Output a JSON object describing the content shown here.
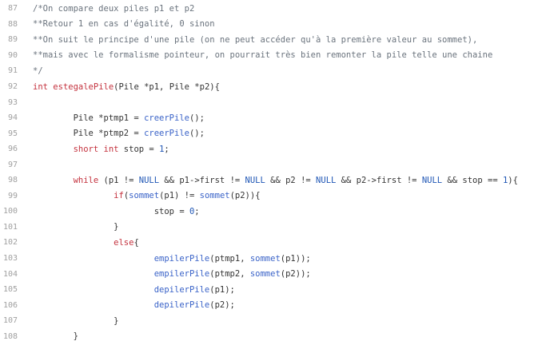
{
  "colors": {
    "line_number": "#a0a0a0",
    "comment": "#6a737d",
    "keyword": "#c4323e",
    "function": "#3a63c8",
    "constant": "#1f56b5",
    "text": "#333333",
    "background": "#ffffff"
  },
  "lines": [
    {
      "num": "87",
      "tokens": [
        {
          "t": "c",
          "v": "/*On compare deux piles p1 et p2"
        }
      ]
    },
    {
      "num": "88",
      "tokens": [
        {
          "t": "c",
          "v": "**Retour 1 en cas d'égalité, 0 sinon"
        }
      ]
    },
    {
      "num": "89",
      "tokens": [
        {
          "t": "c",
          "v": "**On suit le principe d'une pile (on ne peut accéder qu'à la première valeur au sommet),"
        }
      ]
    },
    {
      "num": "90",
      "tokens": [
        {
          "t": "c",
          "v": "**mais avec le formalisme pointeur, on pourrait très bien remonter la pile telle une chaine"
        }
      ]
    },
    {
      "num": "91",
      "tokens": [
        {
          "t": "c",
          "v": "*/"
        }
      ]
    },
    {
      "num": "92",
      "tokens": [
        {
          "t": "k",
          "v": "int"
        },
        {
          "t": "p",
          "v": " "
        },
        {
          "t": "k",
          "v": "estegalePile"
        },
        {
          "t": "p",
          "v": "(Pile *p1, Pile *p2){"
        }
      ]
    },
    {
      "num": "93",
      "tokens": []
    },
    {
      "num": "94",
      "tokens": [
        {
          "t": "p",
          "v": "        Pile *ptmp1 = "
        },
        {
          "t": "f",
          "v": "creerPile"
        },
        {
          "t": "p",
          "v": "();"
        }
      ]
    },
    {
      "num": "95",
      "tokens": [
        {
          "t": "p",
          "v": "        Pile *ptmp2 = "
        },
        {
          "t": "f",
          "v": "creerPile"
        },
        {
          "t": "p",
          "v": "();"
        }
      ]
    },
    {
      "num": "96",
      "tokens": [
        {
          "t": "p",
          "v": "        "
        },
        {
          "t": "k",
          "v": "short"
        },
        {
          "t": "p",
          "v": " "
        },
        {
          "t": "k",
          "v": "int"
        },
        {
          "t": "p",
          "v": " stop = "
        },
        {
          "t": "n",
          "v": "1"
        },
        {
          "t": "p",
          "v": ";"
        }
      ]
    },
    {
      "num": "97",
      "tokens": []
    },
    {
      "num": "98",
      "tokens": [
        {
          "t": "p",
          "v": "        "
        },
        {
          "t": "k",
          "v": "while"
        },
        {
          "t": "p",
          "v": " (p1 != "
        },
        {
          "t": "n",
          "v": "NULL"
        },
        {
          "t": "p",
          "v": " && p1->first != "
        },
        {
          "t": "n",
          "v": "NULL"
        },
        {
          "t": "p",
          "v": " && p2 != "
        },
        {
          "t": "n",
          "v": "NULL"
        },
        {
          "t": "p",
          "v": " && p2->first != "
        },
        {
          "t": "n",
          "v": "NULL"
        },
        {
          "t": "p",
          "v": " && stop == "
        },
        {
          "t": "n",
          "v": "1"
        },
        {
          "t": "p",
          "v": "){"
        }
      ]
    },
    {
      "num": "99",
      "tokens": [
        {
          "t": "p",
          "v": "                "
        },
        {
          "t": "k",
          "v": "if"
        },
        {
          "t": "p",
          "v": "("
        },
        {
          "t": "f",
          "v": "sommet"
        },
        {
          "t": "p",
          "v": "(p1) != "
        },
        {
          "t": "f",
          "v": "sommet"
        },
        {
          "t": "p",
          "v": "(p2)){"
        }
      ]
    },
    {
      "num": "100",
      "tokens": [
        {
          "t": "p",
          "v": "                        stop = "
        },
        {
          "t": "n",
          "v": "0"
        },
        {
          "t": "p",
          "v": ";"
        }
      ]
    },
    {
      "num": "101",
      "tokens": [
        {
          "t": "p",
          "v": "                }"
        }
      ]
    },
    {
      "num": "102",
      "tokens": [
        {
          "t": "p",
          "v": "                "
        },
        {
          "t": "k",
          "v": "else"
        },
        {
          "t": "p",
          "v": "{"
        }
      ]
    },
    {
      "num": "103",
      "tokens": [
        {
          "t": "p",
          "v": "                        "
        },
        {
          "t": "f",
          "v": "empilerPile"
        },
        {
          "t": "p",
          "v": "(ptmp1, "
        },
        {
          "t": "f",
          "v": "sommet"
        },
        {
          "t": "p",
          "v": "(p1));"
        }
      ]
    },
    {
      "num": "104",
      "tokens": [
        {
          "t": "p",
          "v": "                        "
        },
        {
          "t": "f",
          "v": "empilerPile"
        },
        {
          "t": "p",
          "v": "(ptmp2, "
        },
        {
          "t": "f",
          "v": "sommet"
        },
        {
          "t": "p",
          "v": "(p2));"
        }
      ]
    },
    {
      "num": "105",
      "tokens": [
        {
          "t": "p",
          "v": "                        "
        },
        {
          "t": "f",
          "v": "depilerPile"
        },
        {
          "t": "p",
          "v": "(p1);"
        }
      ]
    },
    {
      "num": "106",
      "tokens": [
        {
          "t": "p",
          "v": "                        "
        },
        {
          "t": "f",
          "v": "depilerPile"
        },
        {
          "t": "p",
          "v": "(p2);"
        }
      ]
    },
    {
      "num": "107",
      "tokens": [
        {
          "t": "p",
          "v": "                }"
        }
      ]
    },
    {
      "num": "108",
      "tokens": [
        {
          "t": "p",
          "v": "        }"
        }
      ]
    }
  ]
}
